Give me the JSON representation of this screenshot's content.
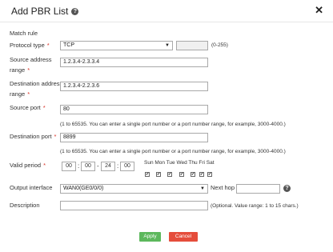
{
  "header": {
    "title": "Add PBR List"
  },
  "form": {
    "section": "Match rule",
    "protocol_label": "Protocol type",
    "protocol_value": "TCP",
    "protocol_range": "(0-255)",
    "src_label_1": "Source address",
    "src_label_2": "range",
    "src_value": "1.2.3.4-2.3.3.4",
    "dst_label_1": "Destination address",
    "dst_label_2": "range",
    "dst_value": "1.2.3.4-2.2.3.6",
    "src_port_label": "Source port",
    "src_port_value": "80",
    "port_hint": "(1 to 65535. You can enter a single port number or a port number range, for example, 3000-4000.)",
    "dst_port_label": "Destination port",
    "dst_port_value": "8899",
    "valid_label": "Valid period",
    "time": [
      "00",
      "00",
      "24",
      "00"
    ],
    "days": "Sun Mon Tue Wed Thu Fri Sat",
    "output_label": "Output interface",
    "output_value": "WAN0(GE0/0/0)",
    "nexthop_label": "Next hop",
    "desc_label": "Description",
    "desc_hint": "(Optional. Value range: 1 to 15 chars.)",
    "apply": "Apply",
    "cancel": "Cancel",
    "req": "*",
    "check": "✔",
    "colon": ":",
    "dash": "-"
  }
}
